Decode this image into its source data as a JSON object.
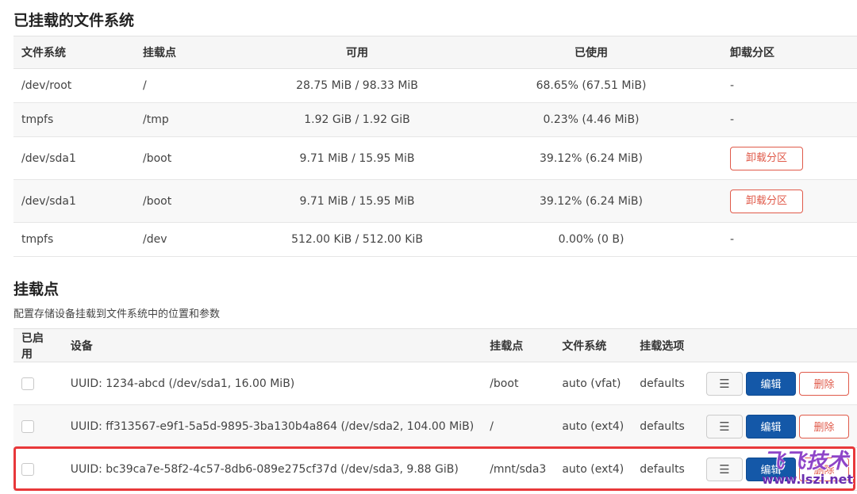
{
  "mounted": {
    "title": "已挂载的文件系统",
    "headers": [
      "文件系统",
      "挂载点",
      "可用",
      "已使用",
      "卸载分区"
    ],
    "rows": [
      {
        "fs": "/dev/root",
        "mount": "/",
        "avail": "28.75 MiB / 98.33 MiB",
        "used": "68.65% (67.51 MiB)",
        "unmount": "-"
      },
      {
        "fs": "tmpfs",
        "mount": "/tmp",
        "avail": "1.92 GiB / 1.92 GiB",
        "used": "0.23% (4.46 MiB)",
        "unmount": "-"
      },
      {
        "fs": "/dev/sda1",
        "mount": "/boot",
        "avail": "9.71 MiB / 15.95 MiB",
        "used": "39.12% (6.24 MiB)",
        "unmount": "卸载分区"
      },
      {
        "fs": "/dev/sda1",
        "mount": "/boot",
        "avail": "9.71 MiB / 15.95 MiB",
        "used": "39.12% (6.24 MiB)",
        "unmount": "卸载分区"
      },
      {
        "fs": "tmpfs",
        "mount": "/dev",
        "avail": "512.00 KiB / 512.00 KiB",
        "used": "0.00% (0 B)",
        "unmount": "-"
      }
    ]
  },
  "mountpoints": {
    "title": "挂载点",
    "description": "配置存储设备挂载到文件系统中的位置和参数",
    "headers": [
      "已启用",
      "设备",
      "挂载点",
      "文件系统",
      "挂载选项"
    ],
    "rows": [
      {
        "enabled": false,
        "device": "UUID: 1234-abcd (/dev/sda1, 16.00 MiB)",
        "mount": "/boot",
        "fs": "auto (vfat)",
        "options": "defaults"
      },
      {
        "enabled": false,
        "device": "UUID: ff313567-e9f1-5a5d-9895-3ba130b4a864 (/dev/sda2, 104.00 MiB)",
        "mount": "/",
        "fs": "auto (ext4)",
        "options": "defaults"
      },
      {
        "enabled": false,
        "device": "UUID: bc39ca7e-58f2-4c57-8db6-089e275cf37d (/dev/sda3, 9.88 GiB)",
        "mount": "/mnt/sda3",
        "fs": "auto (ext4)",
        "options": "defaults"
      }
    ],
    "actions": {
      "menu": "☰",
      "edit": "编辑",
      "delete": "删除"
    }
  },
  "watermark": {
    "text": "飞飞技术",
    "url": "www.lszi.net"
  },
  "colors": {
    "accent": "#1458a8",
    "danger": "#e05a4a",
    "highlight": "#e8383a"
  }
}
